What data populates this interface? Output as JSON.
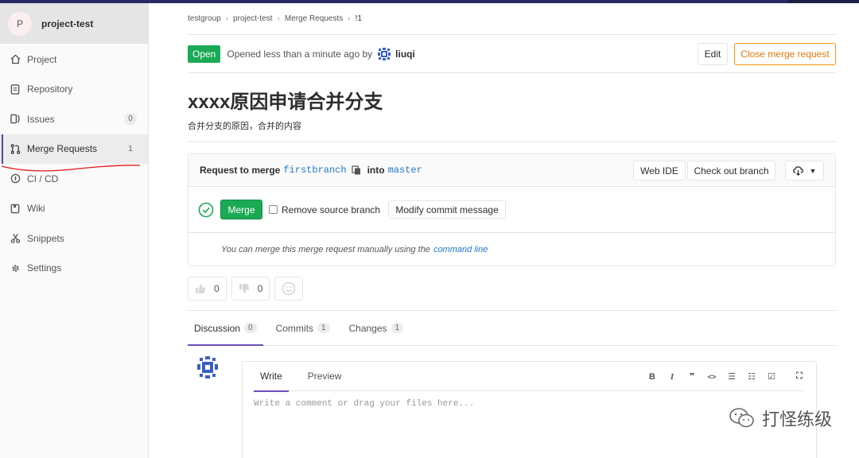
{
  "sidebar": {
    "project_initial": "P",
    "project_name": "project-test",
    "items": [
      {
        "label": "Project",
        "icon": "home-icon"
      },
      {
        "label": "Repository",
        "icon": "book-icon"
      },
      {
        "label": "Issues",
        "icon": "issues-icon",
        "count": "0"
      },
      {
        "label": "Merge Requests",
        "icon": "merge-request-icon",
        "count": "1",
        "active": true
      },
      {
        "label": "CI / CD",
        "icon": "rocket-icon"
      },
      {
        "label": "Wiki",
        "icon": "wiki-icon"
      },
      {
        "label": "Snippets",
        "icon": "scissors-icon"
      },
      {
        "label": "Settings",
        "icon": "gear-icon"
      }
    ]
  },
  "breadcrumb": {
    "items": [
      "testgroup",
      "project-test",
      "Merge Requests",
      "!1"
    ]
  },
  "mr": {
    "status": "Open",
    "opened_text": "Opened less than a minute ago by",
    "author": "liuqi",
    "edit_label": "Edit",
    "close_label": "Close merge request",
    "title": "xxxx原因申请合并分支",
    "description": "合并分支的原因，合并的内容"
  },
  "widget": {
    "request_to_merge": "Request to merge",
    "source_branch": "firstbranch",
    "into": "into",
    "target_branch": "master",
    "web_ide_label": "Web IDE",
    "checkout_label": "Check out branch",
    "merge_label": "Merge",
    "remove_source_label": "Remove source branch",
    "modify_commit_label": "Modify commit message",
    "manual_text": "You can merge this merge request manually using the",
    "command_line_label": "command line"
  },
  "awards": {
    "thumbsup_count": "0",
    "thumbsdown_count": "0"
  },
  "tabs": [
    {
      "label": "Discussion",
      "count": "0"
    },
    {
      "label": "Commits",
      "count": "1"
    },
    {
      "label": "Changes",
      "count": "1"
    }
  ],
  "editor": {
    "write_label": "Write",
    "preview_label": "Preview",
    "toolbar": [
      "B",
      "I",
      "❞",
      "<>",
      "☰",
      "☷",
      "☑",
      "⛶"
    ],
    "placeholder": "Write a comment or drag your files here..."
  },
  "watermark": {
    "text": "打怪练级"
  },
  "colors": {
    "open_green": "#1aaa55",
    "close_orange": "#fc9403",
    "link_blue": "#1f78d1",
    "active_tab_purple": "#6b4fbb",
    "annotation_red": "#e21818"
  }
}
